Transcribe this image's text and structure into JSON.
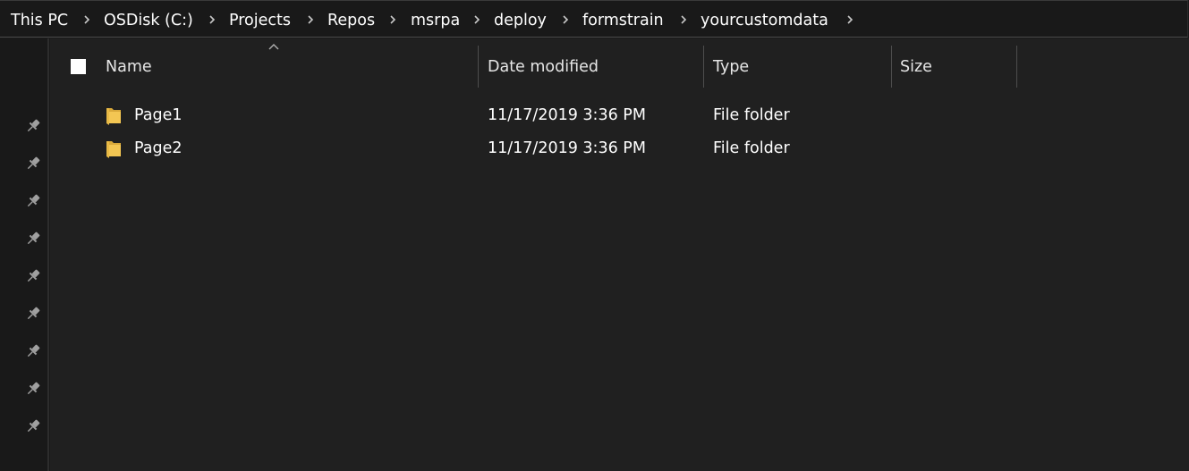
{
  "breadcrumb": [
    {
      "label": "This PC"
    },
    {
      "label": "OSDisk (C:)"
    },
    {
      "label": "Projects"
    },
    {
      "label": "Repos"
    },
    {
      "label": "msrpa"
    },
    {
      "label": "deploy"
    },
    {
      "label": "formstrain"
    },
    {
      "label": "yourcustomdata"
    }
  ],
  "columns": {
    "name": "Name",
    "date_modified": "Date modified",
    "type": "Type",
    "size": "Size"
  },
  "sort": {
    "column": "Name",
    "direction": "ascending"
  },
  "files": [
    {
      "name": "Page1",
      "date_modified": "11/17/2019 3:36 PM",
      "type": "File folder",
      "size": "",
      "icon": "folder-icon"
    },
    {
      "name": "Page2",
      "date_modified": "11/17/2019 3:36 PM",
      "type": "File folder",
      "size": "",
      "icon": "folder-icon"
    }
  ],
  "quick_access_pins": 9,
  "colors": {
    "background": "#202020",
    "nav_background": "#191919",
    "text": "#ffffff",
    "folder": "#f0c04e"
  }
}
